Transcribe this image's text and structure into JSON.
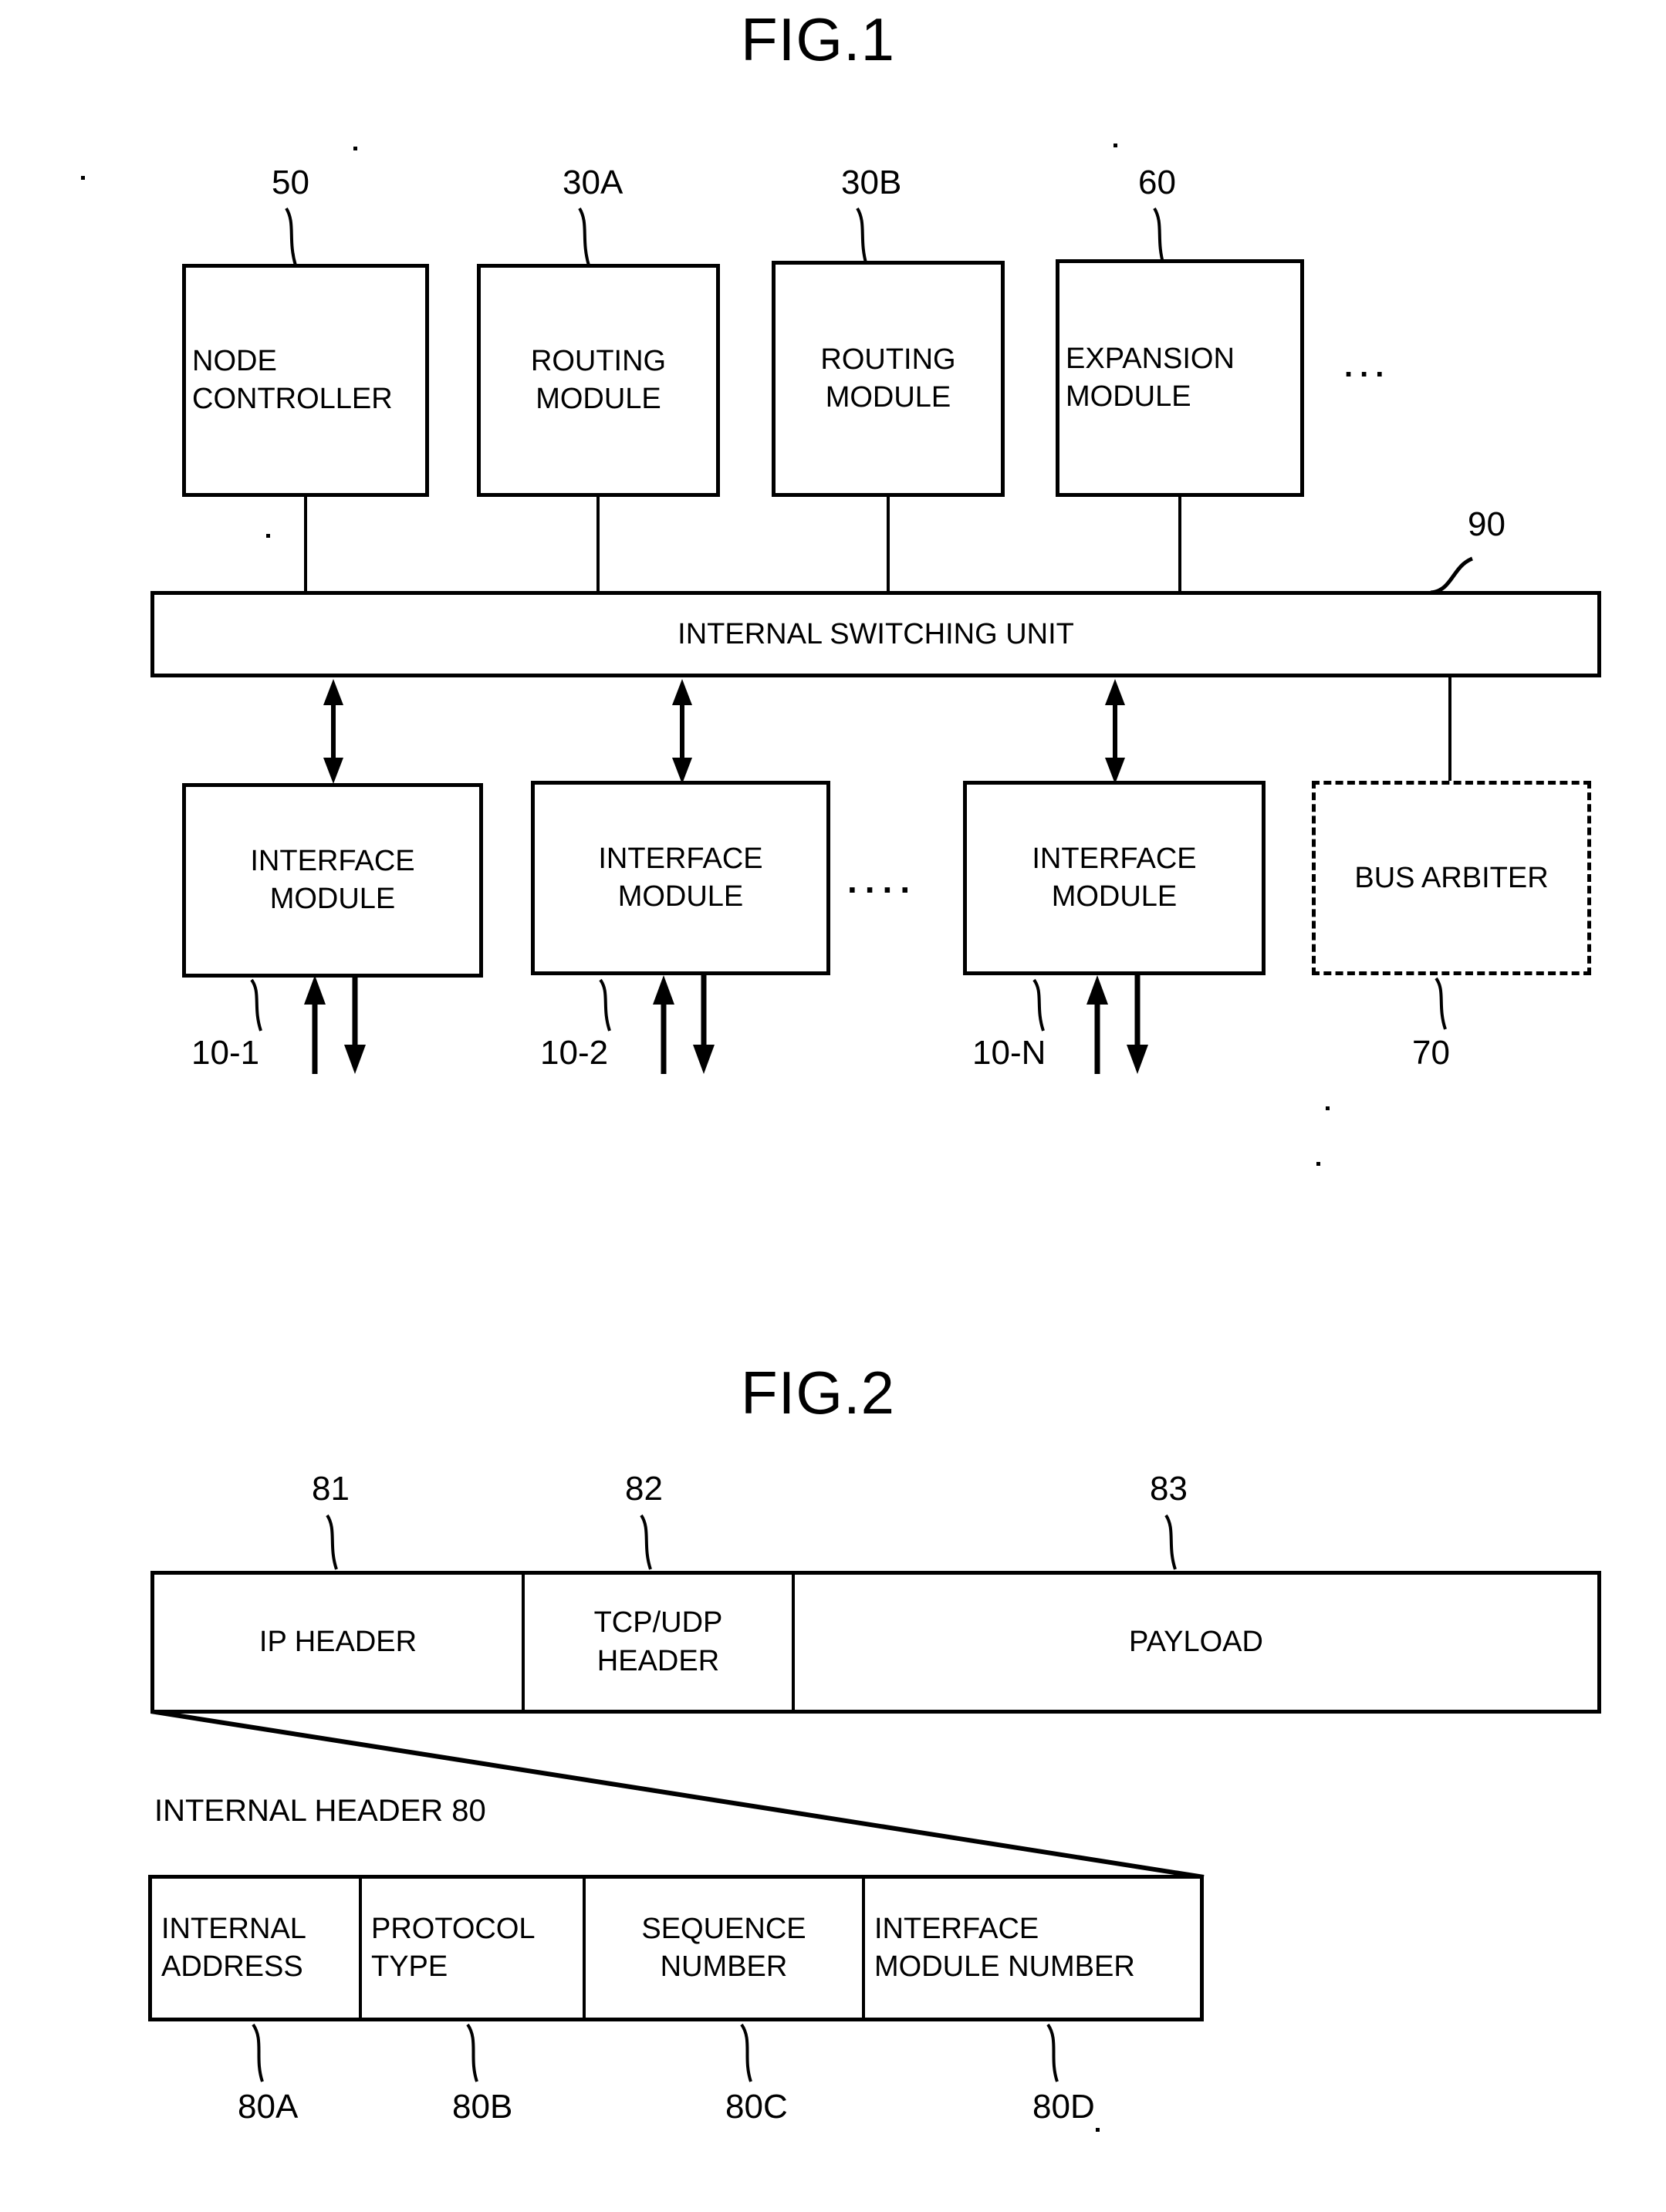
{
  "figures": [
    {
      "title": "FIG.1",
      "top_modules": [
        {
          "ref": "50",
          "label": "NODE\nCONTROLLER"
        },
        {
          "ref": "30A",
          "label": "ROUTING\nMODULE"
        },
        {
          "ref": "30B",
          "label": "ROUTING\nMODULE"
        },
        {
          "ref": "60",
          "label": "EXPANSION\nMODULE"
        }
      ],
      "top_ellipsis": "...",
      "switch_bar": {
        "ref": "90",
        "label": "INTERNAL SWITCHING UNIT"
      },
      "interface_modules": [
        {
          "ref": "10-1",
          "label": "INTERFACE\nMODULE"
        },
        {
          "ref": "10-2",
          "label": "INTERFACE\nMODULE"
        },
        {
          "ref": "10-N",
          "label": "INTERFACE\nMODULE"
        }
      ],
      "interface_ellipsis": "....",
      "arbiter": {
        "ref": "70",
        "label": "BUS ARBITER"
      }
    },
    {
      "title": "FIG.2",
      "packet_fields": [
        {
          "ref": "81",
          "label": "IP HEADER"
        },
        {
          "ref": "82",
          "label": "TCP/UDP\nHEADER"
        },
        {
          "ref": "83",
          "label": "PAYLOAD"
        }
      ],
      "internal_header_caption": "INTERNAL HEADER 80",
      "internal_header_fields": [
        {
          "ref": "80A",
          "label": "INTERNAL\nADDRESS"
        },
        {
          "ref": "80B",
          "label": "PROTOCOL\nTYPE"
        },
        {
          "ref": "80C",
          "label": "SEQUENCE\nNUMBER"
        },
        {
          "ref": "80D",
          "label": "INTERFACE\nMODULE NUMBER"
        }
      ]
    }
  ]
}
